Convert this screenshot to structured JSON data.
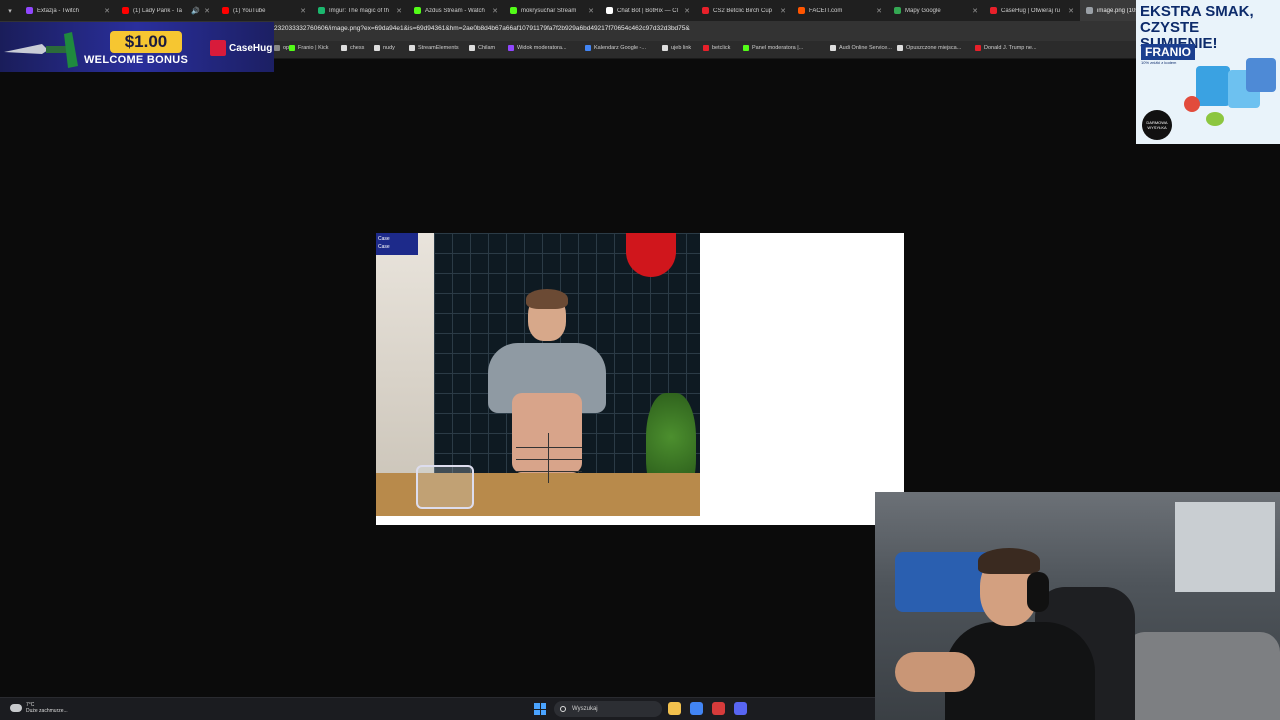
{
  "browser": {
    "tabs": [
      {
        "label": "Extazja - Twitch",
        "favicon_color": "#9147ff"
      },
      {
        "label": "(1) Lady Pank - Ta",
        "favicon_color": "#ff0000",
        "audio": true
      },
      {
        "label": "(1) YouTube",
        "favicon_color": "#ff0000"
      },
      {
        "label": "Imgur: The magic of th",
        "favicon_color": "#1bb76e"
      },
      {
        "label": "Azdus Stream - Watch",
        "favicon_color": "#53fc18"
      },
      {
        "label": "mokrysuchar Stream",
        "favicon_color": "#53fc18"
      },
      {
        "label": "Chat Bot | BotRix — Cl",
        "favicon_color": "#ffffff"
      },
      {
        "label": "CS2 Betclic Birch Cup",
        "favicon_color": "#e8202a"
      },
      {
        "label": "FACEIT.com",
        "favicon_color": "#ff5500"
      },
      {
        "label": "Mapy Google",
        "favicon_color": "#34a853"
      },
      {
        "label": "CaseHug | Otwieraj ru",
        "favicon_color": "#e8202a"
      },
      {
        "label": "image.png (1056",
        "favicon_color": "#9aa0a6",
        "active": true
      }
    ],
    "url": "232033332760606/image.png?ex=69da94e1&is=69d94361&hm=2ae0b8d4b67a66af10791179fa7f2b929a6bd49217f70654c462c97d32d3bd75&",
    "bookmarks": [
      {
        "label": "op",
        "favicon_color": "#888888"
      },
      {
        "label": "Franio | Kick",
        "favicon_color": "#53fc18"
      },
      {
        "label": "chess",
        "favicon_color": "#dddddd"
      },
      {
        "label": "nudy",
        "favicon_color": "#dddddd"
      },
      {
        "label": "StreamElements",
        "favicon_color": "#dddddd"
      },
      {
        "label": "Chilam",
        "favicon_color": "#dddddd"
      },
      {
        "label": "Widok moderatora...",
        "favicon_color": "#9147ff"
      },
      {
        "label": "Kalendarz Google -...",
        "favicon_color": "#4285f4"
      },
      {
        "label": "ujeb link",
        "favicon_color": "#dddddd"
      },
      {
        "label": "betclick",
        "favicon_color": "#e8202a"
      },
      {
        "label": "Panel moderatora |...",
        "favicon_color": "#53fc18"
      },
      {
        "label": "Audi Online Service...",
        "favicon_color": "#dddddd"
      },
      {
        "label": "Opuszczone miejsca...",
        "favicon_color": "#dddddd"
      },
      {
        "label": "Donald J. Trump ne...",
        "favicon_color": "#e8202a"
      }
    ]
  },
  "ads": {
    "casehug": {
      "amount": "$1.00",
      "text": "WELCOME BONUS",
      "brand": "CaseHug"
    },
    "franio": {
      "headline": "EKSTRA SMAK, CZYSTE SUMIENIE!",
      "brand": "FRANIO",
      "sub": "10% zniżki z kodem",
      "badge": "DARMOWA WYSYŁKA"
    }
  },
  "viewer": {
    "overlay_lines": [
      "Case",
      "Case"
    ]
  },
  "taskbar": {
    "weather_temp": "7°C",
    "weather_desc": "Duże zachmurze...",
    "search_placeholder": "Wyszukaj",
    "apps": [
      {
        "name": "file-explorer-icon",
        "color": "#f2c14e"
      },
      {
        "name": "chrome-icon",
        "color": "#4285f4"
      },
      {
        "name": "app-icon",
        "color": "#d63b3b"
      },
      {
        "name": "discord-icon",
        "color": "#5865f2"
      }
    ]
  }
}
